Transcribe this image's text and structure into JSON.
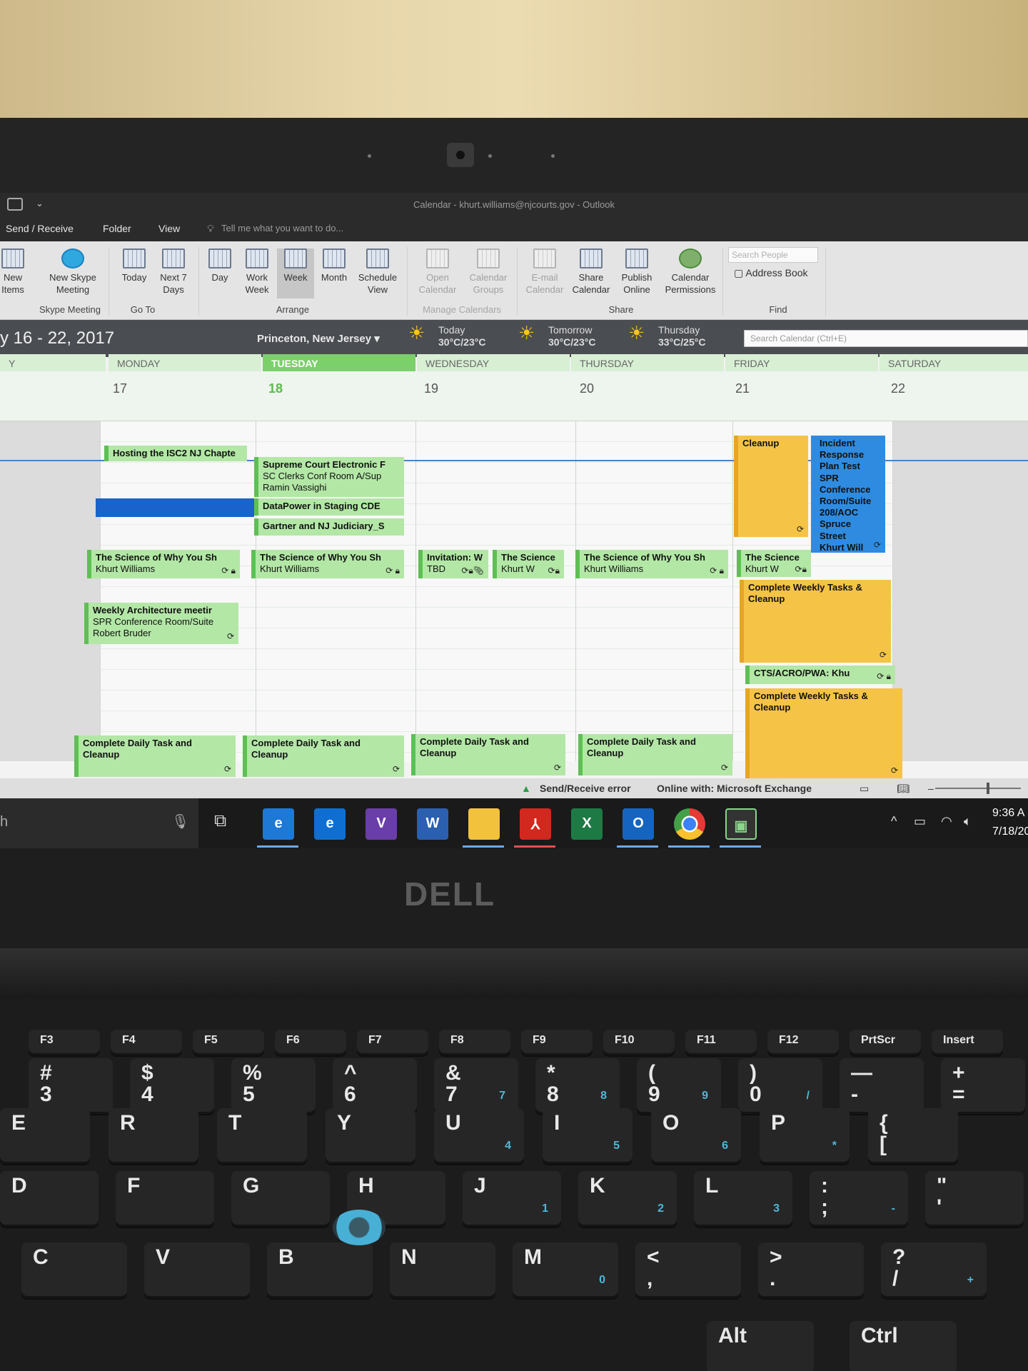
{
  "window": {
    "title": "Calendar - khurt.williams@njcourts.gov - Outlook"
  },
  "menu": {
    "send_receive": "Send / Receive",
    "folder": "Folder",
    "view": "View",
    "tell_me": "Tell me what you want to do..."
  },
  "ribbon": {
    "new_items": "New\nItems",
    "new_skype_meeting": "New Skype\nMeeting",
    "today": "Today",
    "next_7_days": "Next 7\nDays",
    "day": "Day",
    "work_week": "Work\nWeek",
    "week": "Week",
    "month": "Month",
    "schedule_view": "Schedule\nView",
    "open_calendar": "Open\nCalendar",
    "calendar_groups": "Calendar\nGroups",
    "email_calendar": "E-mail\nCalendar",
    "share_calendar": "Share\nCalendar",
    "publish_online": "Publish\nOnline",
    "calendar_permissions": "Calendar\nPermissions",
    "search_people_placeholder": "Search People",
    "address_book": "Address Book",
    "groups": {
      "skype_meeting": "Skype Meeting",
      "go_to": "Go To",
      "arrange": "Arrange",
      "manage_calendars": "Manage Calendars",
      "share": "Share",
      "find": "Find"
    }
  },
  "nav": {
    "date_range": "y 16 - 22, 2017",
    "location": "Princeton, New Jersey",
    "weather": [
      {
        "day": "Today",
        "temps": "30°C/23°C"
      },
      {
        "day": "Tomorrow",
        "temps": "30°C/23°C"
      },
      {
        "day": "Thursday",
        "temps": "33°C/25°C"
      }
    ],
    "search_placeholder": "Search Calendar (Ctrl+E)"
  },
  "days": [
    {
      "name": "Y",
      "num": ""
    },
    {
      "name": "MONDAY",
      "num": "17"
    },
    {
      "name": "TUESDAY",
      "num": "18"
    },
    {
      "name": "WEDNESDAY",
      "num": "19"
    },
    {
      "name": "THURSDAY",
      "num": "20"
    },
    {
      "name": "FRIDAY",
      "num": "21"
    },
    {
      "name": "SATURDAY",
      "num": "22"
    }
  ],
  "events": {
    "mon_isc2": "Hosting the ISC2 NJ Chapte",
    "mon_science": "The Science of Why You Sh",
    "mon_science_who": "Khurt Williams",
    "mon_arch": "Weekly Architecture meetir",
    "mon_arch_loc": "SPR Conference Room/Suite",
    "mon_arch_who": "Robert Bruder",
    "mon_daily": "Complete Daily Task and\nCleanup",
    "tue_supreme": "Supreme Court Electronic F",
    "tue_supreme_loc": "SC Clerks Conf Room A/Sup",
    "tue_supreme_who": "Ramin Vassighi",
    "tue_datapower": "DataPower in Staging CDE",
    "tue_gartner": "Gartner and NJ Judiciary_S",
    "tue_science": "The Science of Why You Sh",
    "tue_science_who": "Khurt Williams",
    "tue_daily": "Complete Daily Task and\nCleanup",
    "wed_invite": "Invitation: W",
    "wed_invite_who": "TBD",
    "wed_science": "The Science",
    "wed_science_who": "Khurt W",
    "wed_daily": "Complete Daily Task and\nCleanup",
    "thu_science": "The Science of Why You Sh",
    "thu_science_who": "Khurt Williams",
    "thu_daily": "Complete Daily Task and\nCleanup",
    "fri_cleanup_top": "Cleanup",
    "fri_incident": "Incident\nResponse\nPlan Test\nSPR\nConference\nRoom/Suite\n208/AOC\nSpruce\nStreet\nKhurt Will",
    "fri_science": "The Science",
    "fri_science_who": "Khurt W",
    "fri_weekly1": "Complete Weekly Tasks &\nCleanup",
    "fri_cts": "CTS/ACRO/PWA: Khu",
    "fri_weekly2": "Complete Weekly Tasks &\nCleanup"
  },
  "status": {
    "error": "Send/Receive error",
    "online": "Online with: Microsoft Exchange"
  },
  "taskbar": {
    "search_fragment": "h",
    "apps": [
      "Internet Explorer",
      "Edge",
      "Visual Studio",
      "Word",
      "File Explorer",
      "Acrobat",
      "Excel",
      "Outlook",
      "Chrome",
      "Terminal"
    ],
    "time": "9:36 A",
    "date": "7/18/20"
  },
  "hardware": {
    "brand": "DELL"
  },
  "keyboard": {
    "fn_keys": [
      "F3",
      "F4",
      "F5",
      "F6",
      "F7",
      "F8",
      "F9",
      "F10",
      "F11",
      "F12",
      "PrtScr",
      "Insert"
    ],
    "number_row": [
      "#\n3",
      "$\n4",
      "%\n5",
      "^\n6",
      "&\n7",
      "*\n8",
      "(\n9",
      ")\n0",
      "—\n-",
      "+\n="
    ],
    "number_row_sub": [
      "",
      "",
      "",
      "",
      "7",
      "8",
      "9",
      "/",
      "",
      ""
    ],
    "top_row": [
      "E",
      "R",
      "T",
      "Y",
      "U",
      "I",
      "O",
      "P",
      "{\n["
    ],
    "top_row_sub": [
      "",
      "",
      "",
      "",
      "4",
      "5",
      "6",
      "*",
      ""
    ],
    "home_row": [
      "D",
      "F",
      "G",
      "H",
      "J",
      "K",
      "L",
      ":\n;",
      "\"\n'"
    ],
    "home_row_sub": [
      "",
      "",
      "",
      "",
      "1",
      "2",
      "3",
      "-",
      ""
    ],
    "bottom_row": [
      "C",
      "V",
      "B",
      "N",
      "M",
      "<\n,",
      ">\n.",
      "?\n/"
    ],
    "bottom_row_sub": [
      "",
      "",
      "",
      "",
      "0",
      "",
      "",
      "+"
    ],
    "space_row": [
      "Alt",
      "Ctrl"
    ]
  },
  "colors": {
    "event_green": "#b3e7a6",
    "event_yellow": "#f5c446",
    "event_blue": "#2f8be0",
    "today_header": "#7bd06b"
  }
}
